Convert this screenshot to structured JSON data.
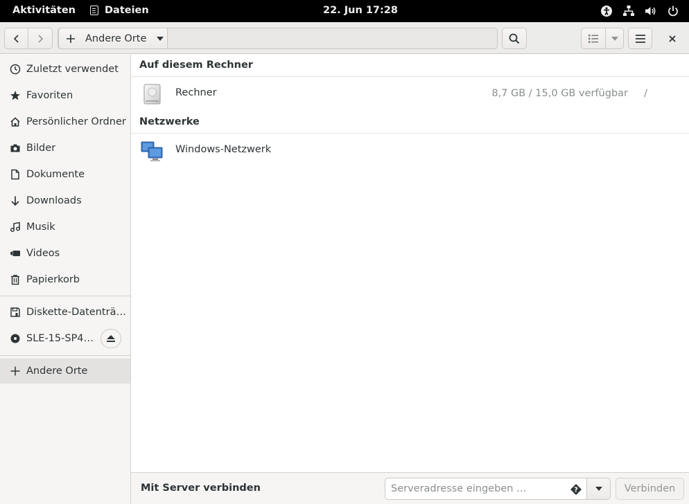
{
  "topbar": {
    "activities": "Aktivitäten",
    "app_name": "Dateien",
    "clock": "22. Jun  17:28",
    "tray_icons": [
      "accessibility-icon",
      "network-icon",
      "volume-icon",
      "power-icon"
    ]
  },
  "header": {
    "path_label": "Andere Orte",
    "icons": {
      "back": "chevron-left-icon",
      "forward": "chevron-right-icon",
      "search": "search-icon",
      "view": "list-view-icon",
      "menu": "hamburger-menu-icon",
      "close": "close-icon"
    }
  },
  "sidebar": {
    "items": [
      {
        "label": "Zuletzt verwendet",
        "icon": "recent-icon"
      },
      {
        "label": "Favoriten",
        "icon": "star-icon"
      },
      {
        "label": "Persönlicher Ordner",
        "icon": "home-icon"
      },
      {
        "label": "Bilder",
        "icon": "camera-icon"
      },
      {
        "label": "Dokumente",
        "icon": "document-icon"
      },
      {
        "label": "Downloads",
        "icon": "download-icon"
      },
      {
        "label": "Musik",
        "icon": "music-icon"
      },
      {
        "label": "Videos",
        "icon": "video-icon"
      },
      {
        "label": "Papierkorb",
        "icon": "trash-icon"
      }
    ],
    "devices": [
      {
        "label": "Diskette-Datenträ…",
        "icon": "floppy-icon"
      },
      {
        "label": "SLE-15-SP4-…",
        "icon": "optical-disc-icon"
      }
    ],
    "other_places": "Andere Orte"
  },
  "main": {
    "section_local": "Auf diesem Rechner",
    "section_network": "Netzwerke",
    "local_items": [
      {
        "label": "Rechner",
        "info": "8,7 GB / 15,0 GB verfügbar",
        "mount": "/"
      }
    ],
    "network_items": [
      {
        "label": "Windows-Netzwerk"
      }
    ]
  },
  "bottom": {
    "label": "Mit Server verbinden",
    "placeholder": "Serveradresse eingeben …",
    "connect_label": "Verbinden"
  },
  "colors": {
    "accent_blue": "#3b79c6",
    "active_row": "#e4e2e0",
    "topbar": "#000000"
  }
}
